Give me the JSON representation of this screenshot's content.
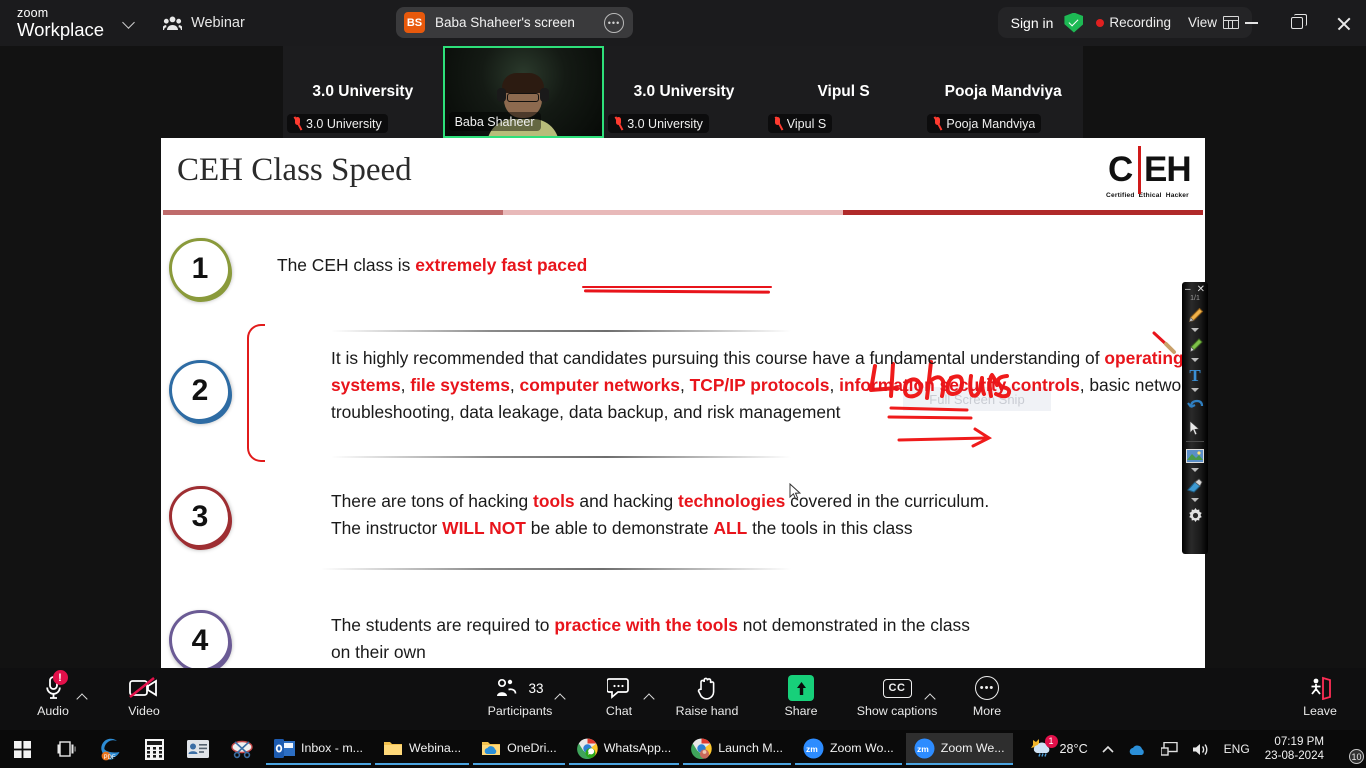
{
  "titlebar": {
    "brand_line1": "zoom",
    "brand_line2": "Workplace",
    "meeting_type": "Webinar",
    "share_avatar_initials": "BS",
    "share_title": "Baba Shaheer's screen",
    "sign_in": "Sign in",
    "recording": "Recording",
    "view": "View",
    "accent_green": "#1db954",
    "recording_red": "#e02020"
  },
  "participants": [
    {
      "name": "3.0 University",
      "label": "3.0 University",
      "muted": true,
      "video": false,
      "active": false
    },
    {
      "name": "Baba Shaheer",
      "label": "Baba Shaheer",
      "muted": false,
      "video": true,
      "active": true
    },
    {
      "name": "3.0 University",
      "label": "3.0 University",
      "muted": true,
      "video": false,
      "active": false
    },
    {
      "name": "Vipul S",
      "label": "Vipul S",
      "muted": true,
      "video": false,
      "active": false
    },
    {
      "name": "Pooja Mandviya",
      "label": "Pooja Mandviya",
      "muted": true,
      "video": false,
      "active": false
    }
  ],
  "slide": {
    "title": "CEH Class Speed",
    "logo": {
      "c": "C",
      "eh": "EH",
      "sub1": "Certified",
      "sub2": "Ethical",
      "sub3": "Hacker",
      "bar_color": "#d01a1a"
    },
    "points": [
      {
        "number": "1",
        "badge_color": "#8a9a3b",
        "segments": [
          {
            "t": "The CEH class is ",
            "red": false
          },
          {
            "t": "extremely fast paced",
            "red": true
          }
        ]
      },
      {
        "number": "2",
        "badge_color": "#2e6ca4",
        "segments": [
          {
            "t": "It is highly recommended that candidates pursuing this course have a fundamental understanding of ",
            "red": false
          },
          {
            "t": "operating systems",
            "red": true
          },
          {
            "t": ", ",
            "red": false
          },
          {
            "t": "file systems",
            "red": true
          },
          {
            "t": ", ",
            "red": false
          },
          {
            "t": "computer networks",
            "red": true
          },
          {
            "t": ", ",
            "red": false
          },
          {
            "t": "TCP/IP protocols",
            "red": true
          },
          {
            "t": ", ",
            "red": false
          },
          {
            "t": "information security controls",
            "red": true
          },
          {
            "t": ", basic network troubleshooting, data leakage, data backup, and risk management",
            "red": false
          }
        ]
      },
      {
        "number": "3",
        "badge_color": "#9e2e32",
        "segments": [
          {
            "t": "There are tons of hacking ",
            "red": false
          },
          {
            "t": "tools",
            "red": true
          },
          {
            "t": " and hacking ",
            "red": false
          },
          {
            "t": "technologies",
            "red": true
          },
          {
            "t": " covered in the curriculum.",
            "red": false
          },
          {
            "t": "\n",
            "red": false
          },
          {
            "t": "The instructor ",
            "red": false
          },
          {
            "t": "WILL NOT",
            "red": true
          },
          {
            "t": " be able to demonstrate ",
            "red": false
          },
          {
            "t": "ALL",
            "red": true
          },
          {
            "t": " the tools in this class",
            "red": false
          }
        ]
      },
      {
        "number": "4",
        "badge_color": "#6b5b95",
        "segments": [
          {
            "t": "The students are required to ",
            "red": false
          },
          {
            "t": "practice with the tools",
            "red": true
          },
          {
            "t": " not demonstrated in the class",
            "red": false
          },
          {
            "t": "\n",
            "red": false
          },
          {
            "t": "on their own",
            "red": false
          }
        ]
      }
    ],
    "annotation": {
      "handwriting": "40 hours",
      "color": "#ef1b1b"
    },
    "ghost_tooltip": "Full Screen Snip"
  },
  "annotation_toolbar": {
    "page_indicator": "1/1",
    "minimize": "–",
    "close": "✕",
    "tools": [
      {
        "name": "pencil-tool",
        "glyph": "✏"
      },
      {
        "name": "highlighter-tool",
        "glyph": "🖍"
      },
      {
        "name": "text-tool",
        "glyph": "T"
      },
      {
        "name": "undo-tool",
        "glyph": "↶"
      },
      {
        "name": "select-tool",
        "glyph": "➤"
      },
      {
        "name": "image-tool",
        "glyph": "🖼"
      },
      {
        "name": "eraser-tool",
        "glyph": "⟋"
      },
      {
        "name": "settings-tool",
        "glyph": "⚙"
      }
    ]
  },
  "zoom_toolbar": {
    "audio": {
      "label": "Audio",
      "badge": "!"
    },
    "video": {
      "label": "Video"
    },
    "participants": {
      "label": "Participants",
      "count": "33"
    },
    "chat": {
      "label": "Chat"
    },
    "raise_hand": {
      "label": "Raise hand"
    },
    "share": {
      "label": "Share",
      "color": "#17d07a"
    },
    "captions": {
      "label": "Show captions",
      "badge": "CC"
    },
    "more": {
      "label": "More"
    },
    "leave": {
      "label": "Leave",
      "color": "#ff2d55"
    }
  },
  "taskbar": {
    "pinned": [
      {
        "name": "start-button",
        "glyph": "⊞"
      },
      {
        "name": "task-view-button",
        "glyph": "❏"
      },
      {
        "name": "edge-icon",
        "glyph": "e"
      },
      {
        "name": "calculator-icon",
        "glyph": "▦"
      },
      {
        "name": "contacts-icon",
        "glyph": "▤"
      },
      {
        "name": "snipping-tool-icon",
        "glyph": "✂"
      }
    ],
    "apps": [
      {
        "name": "outlook",
        "label": "Inbox - m...",
        "icon": "O",
        "active": false
      },
      {
        "name": "webinar-folder",
        "label": "Webina...",
        "icon": "📁",
        "active": false
      },
      {
        "name": "onedrive-folder",
        "label": "OneDri...",
        "icon": "📁",
        "active": false
      },
      {
        "name": "whatsapp",
        "label": "WhatsApp...",
        "icon": "W",
        "active": false
      },
      {
        "name": "launch-meeting",
        "label": "Launch M...",
        "icon": "C",
        "active": false
      },
      {
        "name": "zoom-workplace",
        "label": "Zoom Wo...",
        "icon": "zm",
        "active": false
      },
      {
        "name": "zoom-webinar",
        "label": "Zoom We...",
        "icon": "zm",
        "active": true
      }
    ],
    "tray": {
      "weather_temp": "28°C",
      "weather_badge": "1",
      "language": "ENG",
      "time": "07:19 PM",
      "date": "23-08-2024",
      "notification_count": "10"
    }
  }
}
